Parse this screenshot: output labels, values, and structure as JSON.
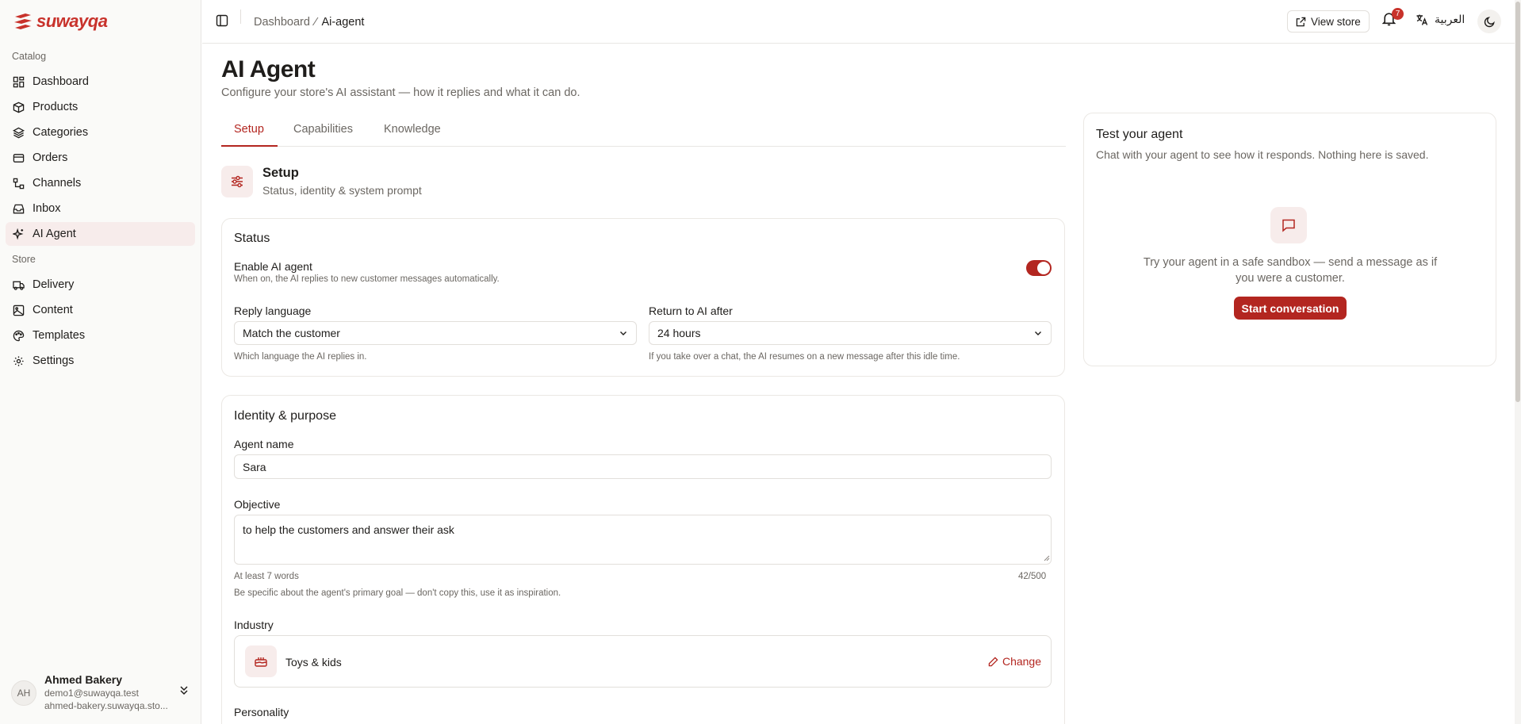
{
  "brand": {
    "name": "suwayqa",
    "accent": "#b32620"
  },
  "sidebar": {
    "sections": [
      "Catalog",
      "Store"
    ],
    "catalog_items": [
      {
        "label": "Dashboard",
        "icon": "dashboard-icon"
      },
      {
        "label": "Products",
        "icon": "box-icon"
      },
      {
        "label": "Categories",
        "icon": "layers-icon"
      },
      {
        "label": "Orders",
        "icon": "card-icon"
      },
      {
        "label": "Channels",
        "icon": "workflow-icon"
      },
      {
        "label": "Inbox",
        "icon": "inbox-icon"
      },
      {
        "label": "AI Agent",
        "icon": "sparkles-icon",
        "active": true
      }
    ],
    "store_items": [
      {
        "label": "Delivery",
        "icon": "truck-icon"
      },
      {
        "label": "Content",
        "icon": "image-icon"
      },
      {
        "label": "Templates",
        "icon": "palette-icon"
      },
      {
        "label": "Settings",
        "icon": "gear-icon"
      }
    ],
    "user": {
      "initials": "AH",
      "name": "Ahmed Bakery",
      "email": "demo1@suwayqa.test",
      "url": "ahmed-bakery.suwayqa.sto..."
    }
  },
  "topbar": {
    "breadcrumb": [
      "Dashboard",
      "Ai-agent"
    ],
    "view_store": "View store",
    "notifications": "7",
    "language": "العربية"
  },
  "page": {
    "title": "AI Agent",
    "subtitle": "Configure your store's AI assistant — how it replies and what it can do.",
    "tabs": [
      "Setup",
      "Capabilities",
      "Knowledge"
    ],
    "active_tab": "Setup"
  },
  "setup": {
    "title": "Setup",
    "subtitle": "Status, identity & system prompt"
  },
  "status": {
    "title": "Status",
    "enable_label": "Enable AI agent",
    "enable_hint": "When on, the AI replies to new customer messages automatically.",
    "enabled": true,
    "reply_language_label": "Reply language",
    "reply_language_value": "Match the customer",
    "reply_language_hint": "Which language the AI replies in.",
    "return_label": "Return to AI after",
    "return_value": "24 hours",
    "return_hint": "If you take over a chat, the AI resumes on a new message after this idle time."
  },
  "identity": {
    "title": "Identity & purpose",
    "agent_name_label": "Agent name",
    "agent_name_value": "Sara",
    "objective_label": "Objective",
    "objective_value": "to help the customers and answer their ask",
    "objective_min": "At least 7 words",
    "objective_counter": "42/500",
    "objective_hint": "Be specific about the agent's primary goal — don't copy this, use it as inspiration.",
    "industry_label": "Industry",
    "industry_value": "Toys & kids",
    "change_label": "Change",
    "personality_label": "Personality"
  },
  "test_panel": {
    "title": "Test your agent",
    "subtitle": "Chat with your agent to see how it responds. Nothing here is saved.",
    "description": "Try your agent in a safe sandbox — send a message as if you were a customer.",
    "button": "Start conversation"
  }
}
